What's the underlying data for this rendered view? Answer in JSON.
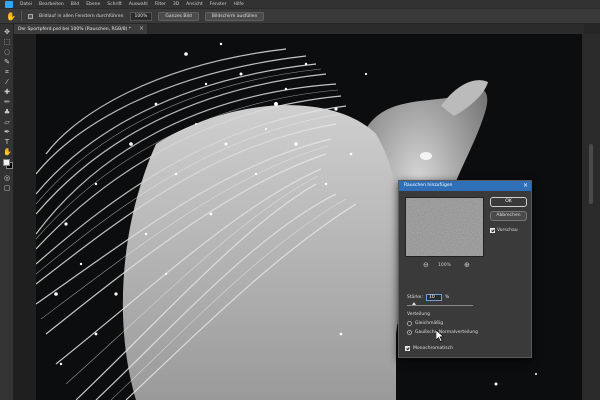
{
  "menubar": {
    "items": [
      "Datei",
      "Bearbeiten",
      "Bild",
      "Ebene",
      "Schrift",
      "Auswahl",
      "Filter",
      "3D",
      "Ansicht",
      "Fenster",
      "Hilfe"
    ]
  },
  "options": {
    "scroll_all_label": "Bildlauf in allen Fenstern durchführen",
    "zoom_value": "100%",
    "fit_screen_label": "Ganzes Bild",
    "fill_screen_label": "Bildschirm ausfüllen"
  },
  "document": {
    "tab_title": "Der Sportpferd.psd bei 100% (Rauschen, RGB/8) *",
    "close_glyph": "×"
  },
  "colors": {
    "accent": "#2f6fb8",
    "foreground": "#f2f2f2",
    "background": "#000000"
  },
  "dialog": {
    "title": "Rauschen hinzufügen",
    "close_glyph": "×",
    "ok_label": "OK",
    "cancel_label": "Abbrechen",
    "preview_label": "Vorschau",
    "preview_checked": true,
    "zoom_percent": "100%",
    "amount_label": "Stärke:",
    "amount_value": "10",
    "amount_unit": "%",
    "amount_fraction": 0.1,
    "distribution_label": "Verteilung",
    "distribution_options": [
      {
        "label": "Gleichmäßig",
        "selected": false
      },
      {
        "label": "Gaußsche Normalverteilung",
        "selected": true
      }
    ],
    "monochrome_label": "Monochromatisch",
    "monochrome_checked": true
  },
  "icons": [
    "hand-icon",
    "move-icon",
    "marquee-icon",
    "lasso-icon",
    "crop-icon",
    "eyedropper-icon",
    "brush-icon",
    "stamp-icon",
    "eraser-icon",
    "pen-icon",
    "type-icon",
    "zoom-icon"
  ]
}
